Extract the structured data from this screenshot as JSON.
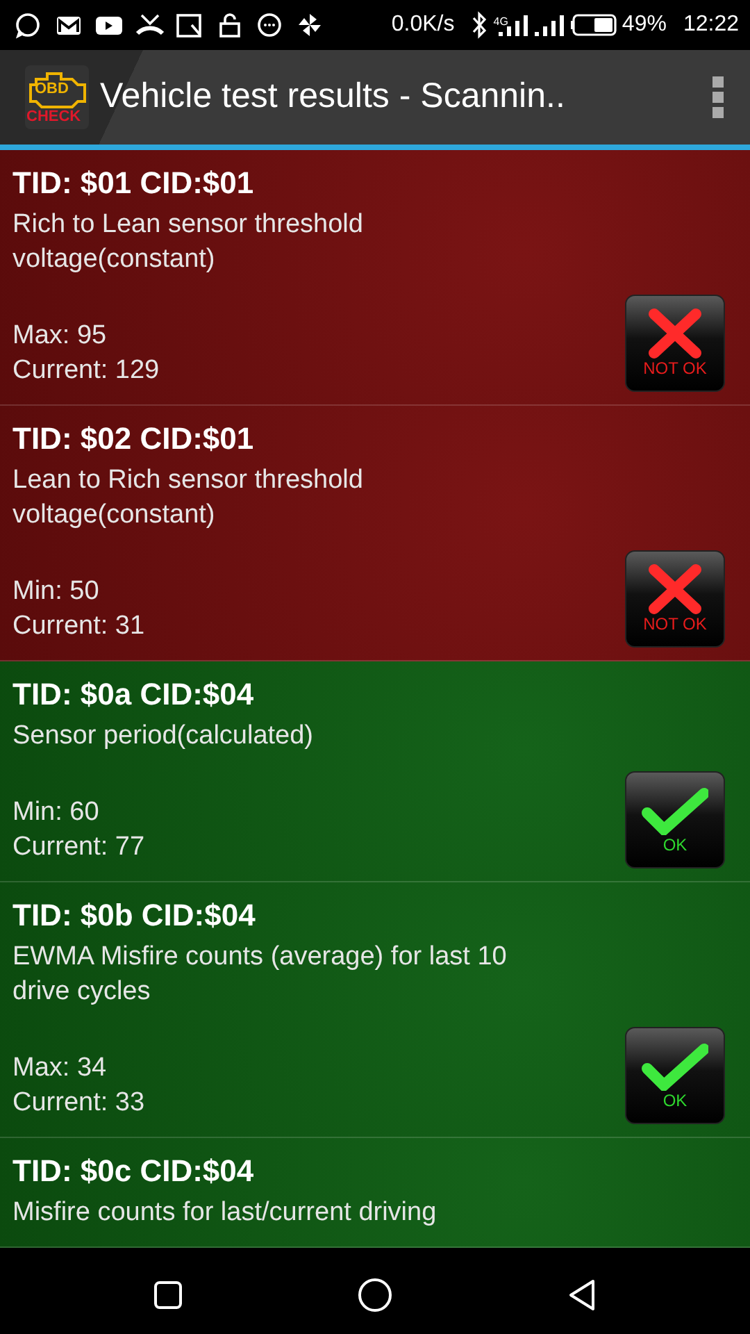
{
  "status_bar": {
    "net_speed": "0.0K/s",
    "network": "4G",
    "battery": "49%",
    "time": "12:22"
  },
  "app_bar": {
    "logo_top": "OBD",
    "logo_bottom": "CHECK",
    "title": "Vehicle test results - Scannin.."
  },
  "results": [
    {
      "title": "TID: $01 CID:$01",
      "description": "Rich to Lean sensor threshold voltage(constant)",
      "limit": "Max: 95",
      "current": "Current: 129",
      "passed": false,
      "badge": "NOT OK"
    },
    {
      "title": "TID: $02 CID:$01",
      "description": "Lean to Rich sensor threshold voltage(constant)",
      "limit": "Min: 50",
      "current": "Current: 31",
      "passed": false,
      "badge": "NOT OK"
    },
    {
      "title": "TID: $0a CID:$04",
      "description": "Sensor period(calculated)",
      "limit": "Min: 60",
      "current": "Current: 77",
      "passed": true,
      "badge": "OK"
    },
    {
      "title": "TID: $0b CID:$04",
      "description": "EWMA Misfire counts (average) for last 10 drive cycles",
      "limit": "Max: 34",
      "current": "Current: 33",
      "passed": true,
      "badge": "OK"
    },
    {
      "title": "TID: $0c CID:$04",
      "description": "Misfire counts for last/current driving",
      "passed": true
    }
  ]
}
